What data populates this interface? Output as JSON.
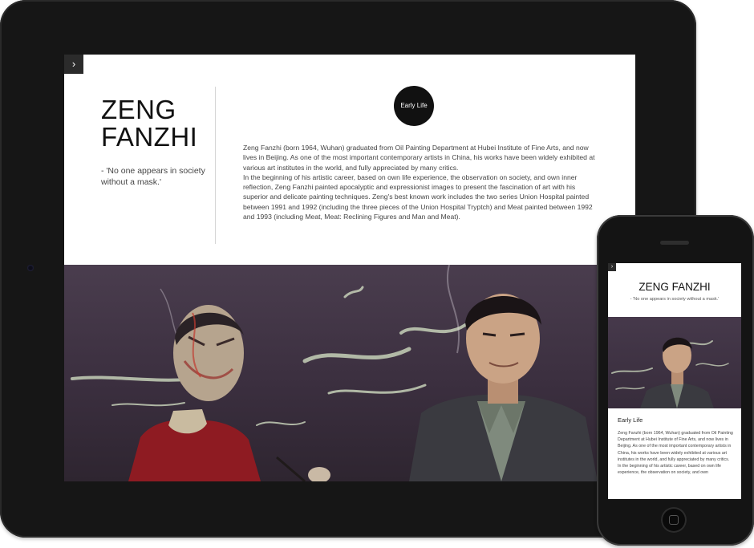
{
  "tablet": {
    "menu_icon": "chevron-right-icon",
    "menu_glyph": "›",
    "artist_name": "ZENG FANZHI",
    "quote": "- 'No one appears in society without a mask.'",
    "section_badge": "Early Life",
    "paragraph_1": "Zeng Fanzhi (born 1964, Wuhan) graduated from Oil Painting Department at Hubei Institute of Fine Arts, and now lives in Beijing. As one of the most important contemporary artists in China, his works have been widely exhibited at various art institutes in the world, and fully appreciated by many critics.",
    "paragraph_2": "In the beginning of his artistic career, based on own life experience, the observation on society, and own inner reflection, Zeng Fanzhi painted apocalyptic and expressionist images to present the fascination of art with his superior and delicate painting techniques. Zeng's best known work includes the two series Union Hospital painted between 1991 and 1992 (including the three pieces of the Union Hospital Tryptch) and Meat painted between 1992 and 1993 (including Meat, Meat: Reclining Figures and Man and Meat)."
  },
  "phone": {
    "menu_icon": "chevron-right-icon",
    "menu_glyph": "›",
    "artist_name": "ZENG FANZHI",
    "quote": "- 'No one appears in society without a mask.'",
    "section_heading": "Early Life",
    "paragraph_1": "Zeng Fanzhi (born 1964, Wuhan) graduated from Oil Painting Department at Hubei Institute of Fine Arts, and now lives in Beijing. As one of the most important contemporary artists in China, his works have been widely exhibited at various art institutes in the world, and fully appreciated by many critics.",
    "paragraph_2": "In the beginning of his artistic career, based on own life experience, the observation on society, and own"
  },
  "colors": {
    "device_frame": "#161616",
    "badge_bg": "#111111",
    "hero_purple": "#3b2f3f",
    "painting_red": "#8e1b22",
    "suit_gray": "#3a3a40",
    "shirt_gray": "#7f8a7d"
  }
}
